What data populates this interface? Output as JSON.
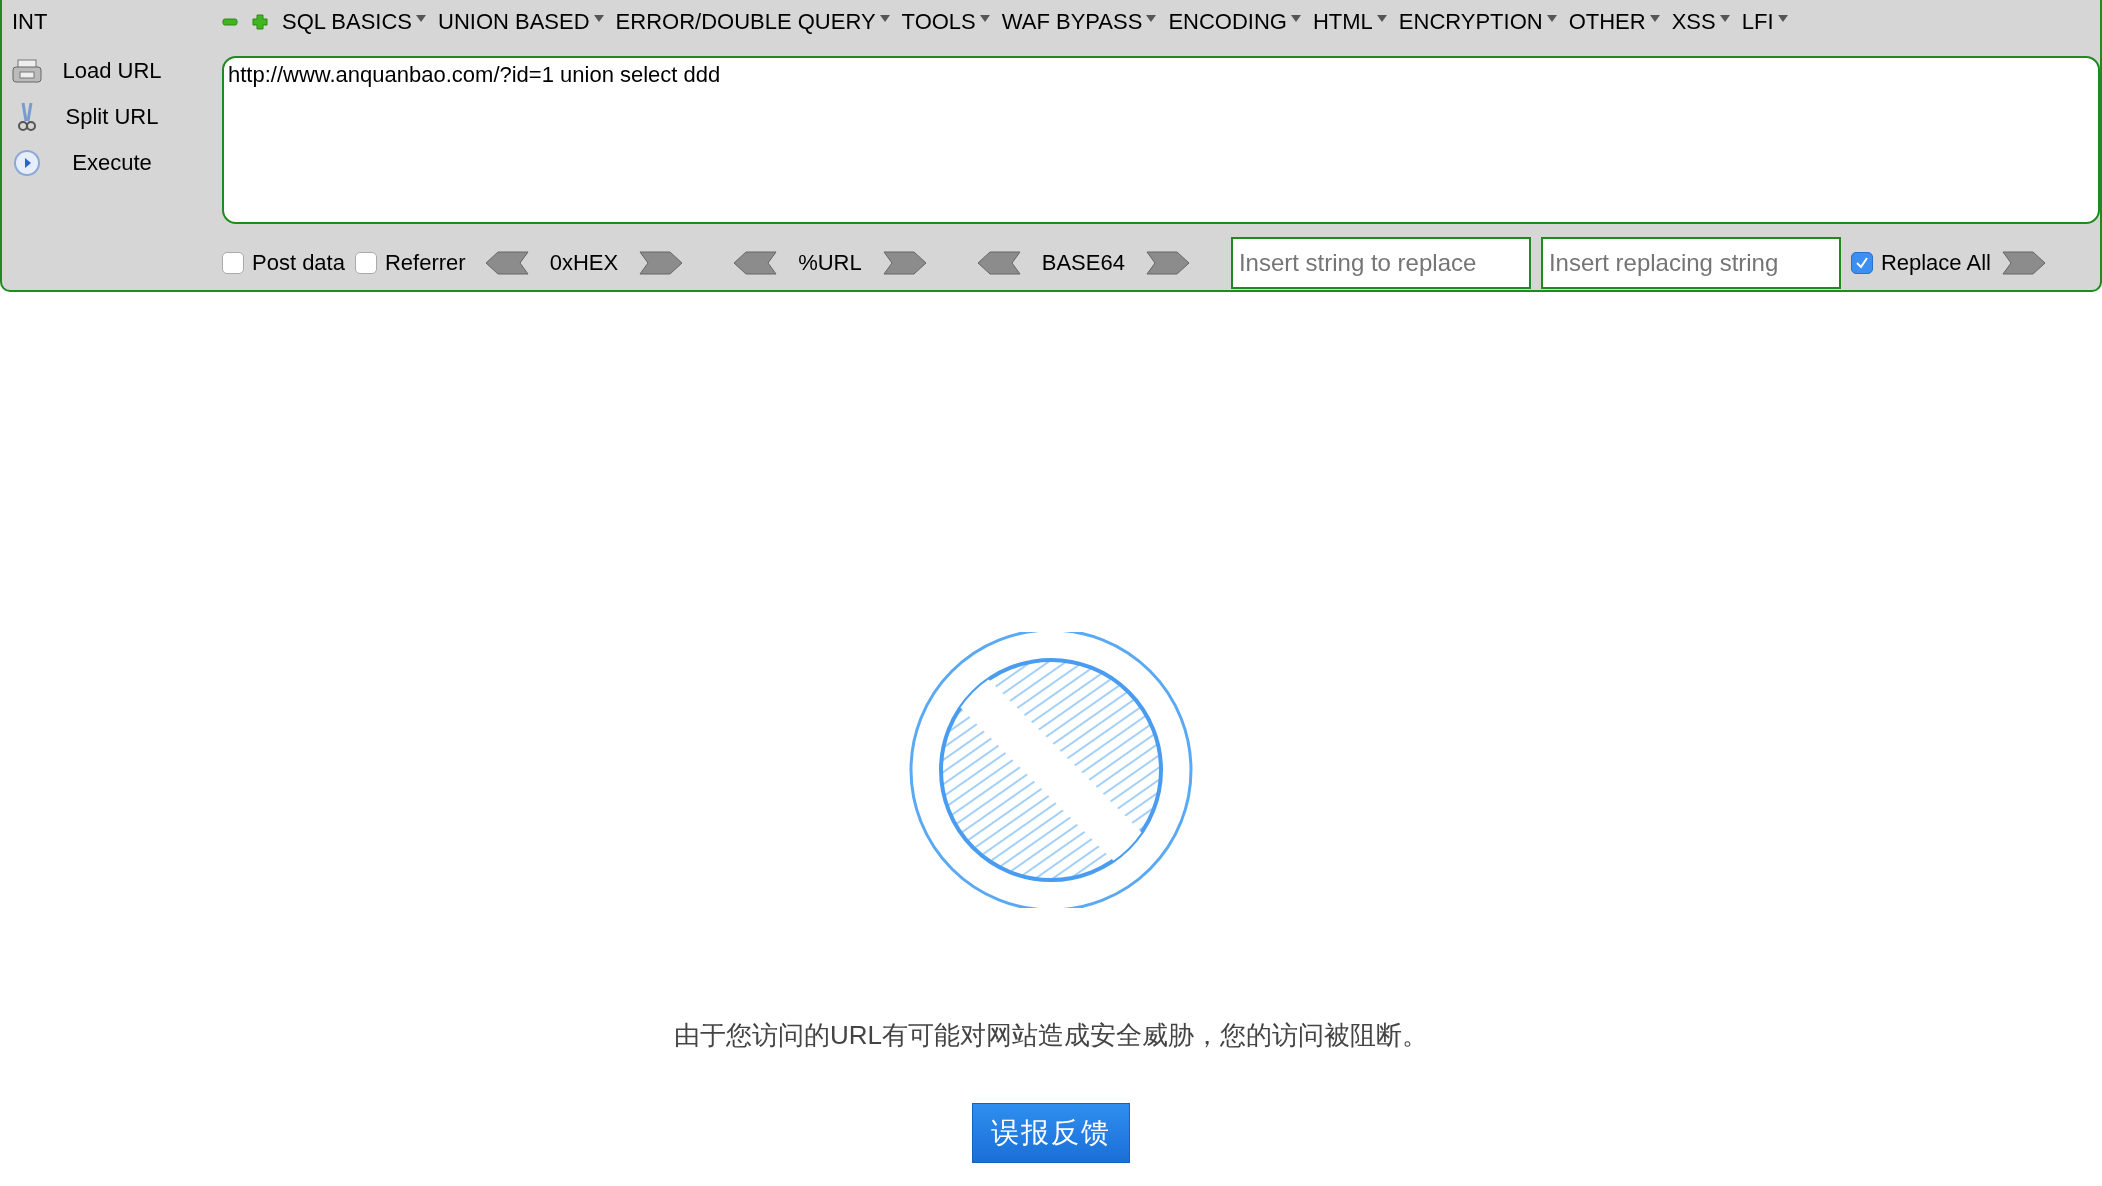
{
  "toolbar": {
    "title": "INT",
    "menus": [
      {
        "label": "SQL BASICS"
      },
      {
        "label": "UNION BASED"
      },
      {
        "label": "ERROR/DOUBLE QUERY"
      },
      {
        "label": "TOOLS"
      },
      {
        "label": "WAF BYPASS"
      },
      {
        "label": "ENCODING"
      },
      {
        "label": "HTML"
      },
      {
        "label": "ENCRYPTION"
      },
      {
        "label": "OTHER"
      },
      {
        "label": "XSS"
      },
      {
        "label": "LFI"
      }
    ],
    "actions": [
      {
        "kind": "load",
        "label": "Load URL"
      },
      {
        "kind": "split",
        "label": "Split URL"
      },
      {
        "kind": "execute",
        "label": "Execute"
      }
    ],
    "url": "http://www.anquanbao.com/?id=1 union select ddd",
    "options": [
      {
        "label": "Post data",
        "checked": false
      },
      {
        "label": "Referrer",
        "checked": false
      }
    ],
    "encoders": [
      {
        "label": "0xHEX"
      },
      {
        "label": "%URL"
      },
      {
        "label": "BASE64"
      }
    ],
    "replace_from": {
      "placeholder": "Insert string to replace"
    },
    "replace_to": {
      "placeholder": "Insert replacing string"
    },
    "replace_all": {
      "label": "Replace All",
      "checked": true
    }
  },
  "page": {
    "message": "由于您访问的URL有可能对网站造成安全威胁，您的访问被阻断。",
    "button": "误报反馈"
  }
}
